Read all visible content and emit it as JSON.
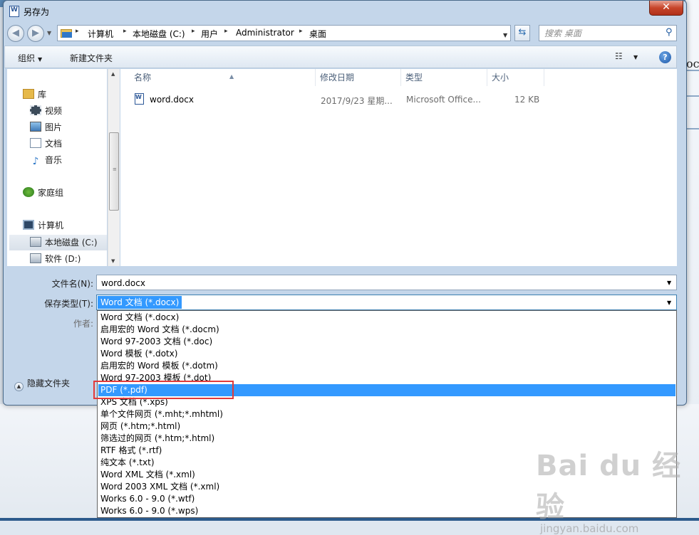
{
  "window": {
    "title": "另存为",
    "close_glyph": "✕"
  },
  "nav": {
    "back_glyph": "◀",
    "forward_glyph": "▶",
    "refresh_glyph": "⇆"
  },
  "address": {
    "breadcrumbs": [
      "计算机",
      "本地磁盘 (C:)",
      "用户",
      "Administrator",
      "桌面"
    ]
  },
  "search": {
    "placeholder": "搜索 桌面",
    "icon": "search-icon"
  },
  "toolbar": {
    "organize_label": "组织",
    "new_folder_label": "新建文件夹",
    "view_glyph": "☷",
    "help_glyph": "?"
  },
  "sidebar": {
    "items": [
      {
        "label": "库",
        "icon": "library-icon"
      },
      {
        "label": "视频",
        "icon": "video-icon"
      },
      {
        "label": "图片",
        "icon": "picture-icon"
      },
      {
        "label": "文档",
        "icon": "document-icon"
      },
      {
        "label": "音乐",
        "icon": "music-icon"
      },
      {
        "label": "家庭组",
        "icon": "homegroup-icon"
      },
      {
        "label": "计算机",
        "icon": "computer-icon"
      },
      {
        "label": "本地磁盘 (C:)",
        "icon": "drive-icon"
      },
      {
        "label": "软件 (D:)",
        "icon": "drive-icon"
      }
    ]
  },
  "file_list": {
    "columns": [
      "名称",
      "修改日期",
      "类型",
      "大小"
    ],
    "rows": [
      {
        "name": "word.docx",
        "modified": "2017/9/23 星期...",
        "type": "Microsoft Office...",
        "size": "12 KB"
      }
    ]
  },
  "form": {
    "filename_label": "文件名(N):",
    "filename_value": "word.docx",
    "savetype_label": "保存类型(T):",
    "savetype_value": "Word 文档 (*.docx)",
    "author_label": "作者:",
    "hide_folders_label": "隐藏文件夹"
  },
  "savetype_options": [
    "Word 文档 (*.docx)",
    "启用宏的 Word 文档 (*.docm)",
    "Word 97-2003 文档 (*.doc)",
    "Word 模板 (*.dotx)",
    "启用宏的 Word 模板 (*.dotm)",
    "Word 97-2003 模板 (*.dot)",
    "PDF (*.pdf)",
    "XPS 文档 (*.xps)",
    "单个文件网页 (*.mht;*.mhtml)",
    "网页 (*.htm;*.html)",
    "筛选过的网页 (*.htm;*.html)",
    "RTF 格式 (*.rtf)",
    "纯文本 (*.txt)",
    "Word XML 文档 (*.xml)",
    "Word 2003 XML 文档 (*.xml)",
    "Works 6.0 - 9.0 (*.wtf)",
    "Works 6.0 - 9.0 (*.wps)"
  ],
  "selected_option_index": 6,
  "watermark": {
    "logo": "Bai du 经验",
    "url": "jingyan.baidu.com"
  },
  "background": {
    "partial_text": "oc"
  },
  "colors": {
    "selection": "#3399ff",
    "highlight_box": "#e23a3a"
  }
}
